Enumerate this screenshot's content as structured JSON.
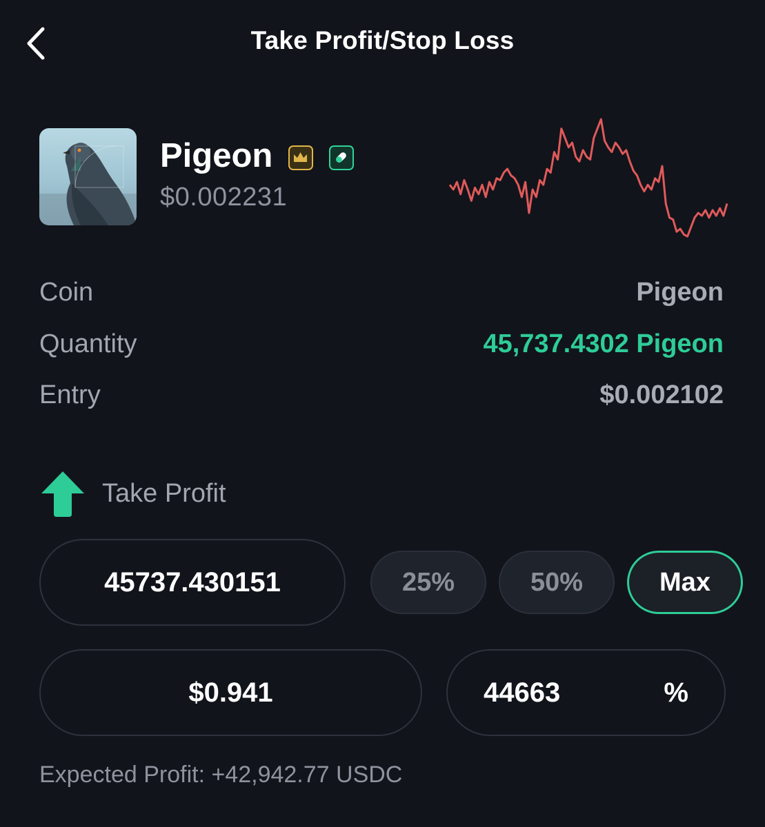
{
  "header": {
    "title": "Take Profit/Stop Loss",
    "back_icon": "chevron-left-icon"
  },
  "coin": {
    "name": "Pigeon",
    "price": "$0.002231",
    "avatar": "pigeon-photo",
    "badges": [
      "crown-icon",
      "pill-icon"
    ],
    "sparkline_color": "#e05a5a",
    "sparkline_values": [
      0.55,
      0.5,
      0.58,
      0.45,
      0.6,
      0.5,
      0.38,
      0.52,
      0.45,
      0.55,
      0.42,
      0.58,
      0.5,
      0.62,
      0.6,
      0.68,
      0.72,
      0.65,
      0.62,
      0.55,
      0.42,
      0.58,
      0.25,
      0.5,
      0.42,
      0.6,
      0.55,
      0.72,
      0.68,
      0.9,
      0.82,
      1.15,
      1.05,
      0.95,
      1.0,
      0.85,
      0.8,
      0.92,
      0.85,
      0.82,
      1.05,
      1.15,
      1.25,
      1.02,
      0.95,
      0.9,
      1.0,
      0.95,
      0.88,
      0.92,
      0.8,
      0.7,
      0.65,
      0.55,
      0.48,
      0.55,
      0.5,
      0.62,
      0.58,
      0.75,
      0.35,
      0.2,
      0.18,
      0.05,
      0.08,
      0.02,
      0.0,
      0.1,
      0.2,
      0.25,
      0.22,
      0.28,
      0.2,
      0.28,
      0.22,
      0.3,
      0.22,
      0.35
    ]
  },
  "details": {
    "coin_label": "Coin",
    "coin_value": "Pigeon",
    "quantity_label": "Quantity",
    "quantity_value": "45,737.4302 Pigeon",
    "entry_label": "Entry",
    "entry_value": "$0.002102"
  },
  "take_profit": {
    "label": "Take Profit",
    "icon": "arrow-up-icon",
    "quantity_input": "45737.430151",
    "chips": [
      "25%",
      "50%",
      "Max"
    ],
    "selected_chip": "Max",
    "price_input": "$0.941",
    "percent_input": "44663",
    "percent_unit": "%",
    "expected_profit": "Expected Profit: +42,942.77 USDC"
  },
  "colors": {
    "background": "#12141b",
    "accent_green": "#2ecc97",
    "sparkline_red": "#e05a5a",
    "badge_gold": "#e1b54a"
  }
}
